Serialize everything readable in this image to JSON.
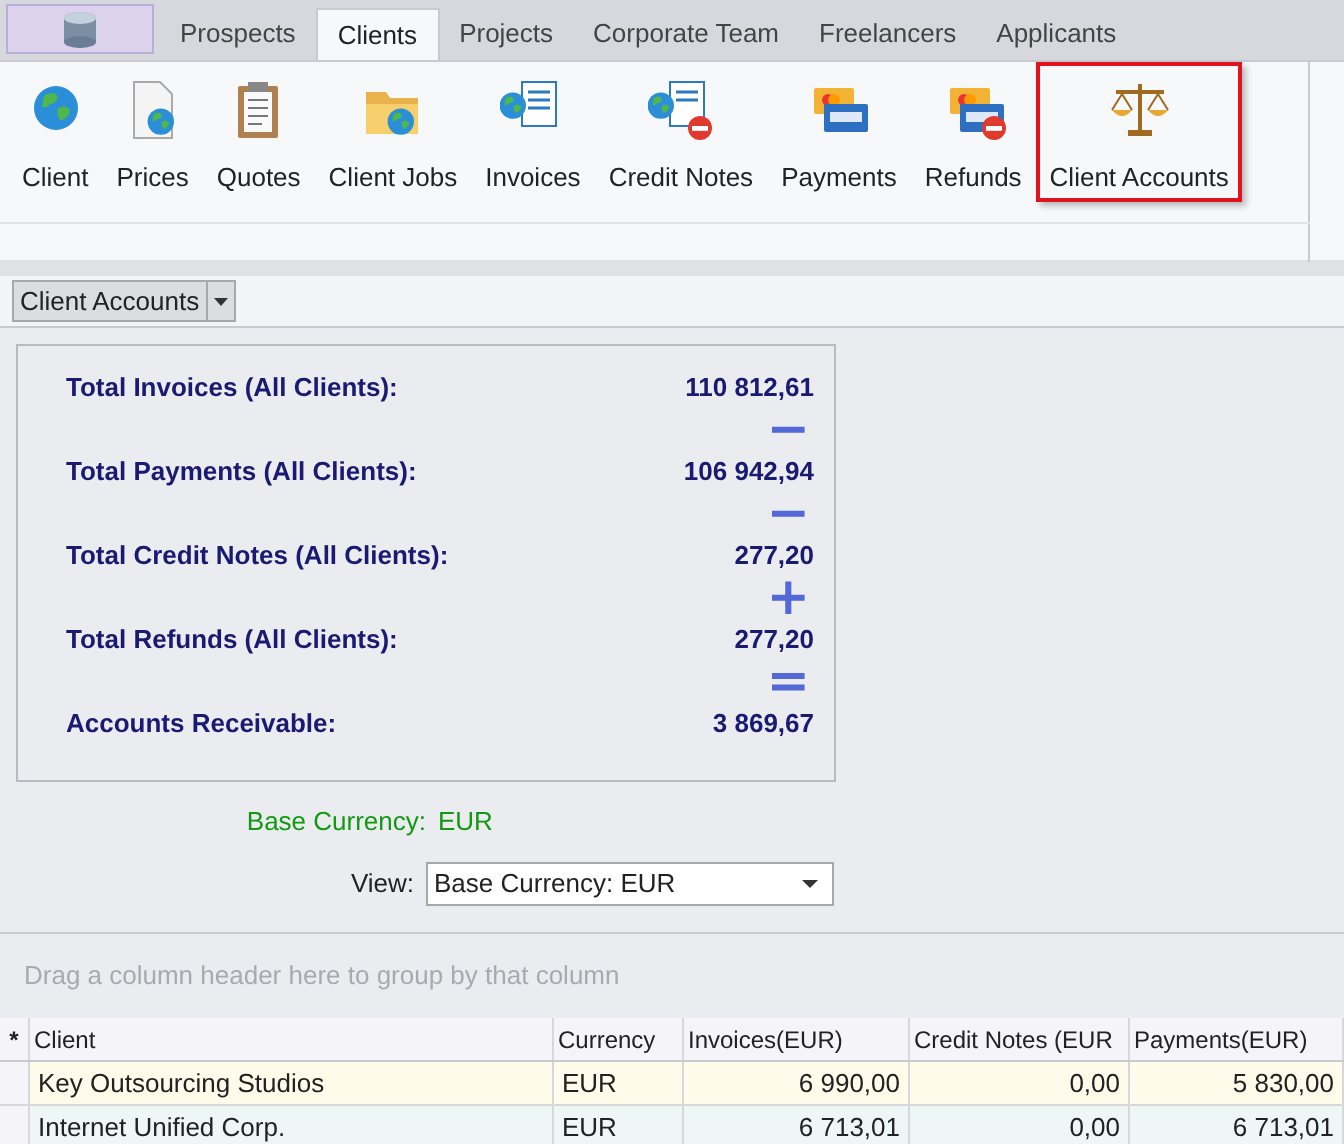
{
  "tabs": [
    {
      "label": "Prospects",
      "selected": false
    },
    {
      "label": "Clients",
      "selected": true
    },
    {
      "label": "Projects",
      "selected": false
    },
    {
      "label": "Corporate Team",
      "selected": false
    },
    {
      "label": "Freelancers",
      "selected": false
    },
    {
      "label": "Applicants",
      "selected": false
    }
  ],
  "ribbon": [
    {
      "label": "Client",
      "selected": false
    },
    {
      "label": "Prices",
      "selected": false
    },
    {
      "label": "Quotes",
      "selected": false
    },
    {
      "label": "Client Jobs",
      "selected": false
    },
    {
      "label": "Invoices",
      "selected": false
    },
    {
      "label": "Credit Notes",
      "selected": false
    },
    {
      "label": "Payments",
      "selected": false
    },
    {
      "label": "Refunds",
      "selected": false
    },
    {
      "label": "Client Accounts",
      "selected": true
    }
  ],
  "view_dropdown": {
    "value": "Client Accounts"
  },
  "summary": [
    {
      "label": "Total Invoices (All Clients):",
      "value": "110 812,61",
      "operator": "−"
    },
    {
      "label": "Total Payments (All Clients):",
      "value": "106 942,94",
      "operator": "−"
    },
    {
      "label": "Total Credit Notes (All Clients):",
      "value": "277,20",
      "operator": "+"
    },
    {
      "label": "Total Refunds (All Clients):",
      "value": "277,20",
      "operator": "="
    },
    {
      "label": "Accounts Receivable:",
      "value": "3 869,67"
    }
  ],
  "base_currency": {
    "label": "Base Currency:",
    "value": "EUR"
  },
  "view": {
    "label": "View:",
    "value": "Base Currency: EUR"
  },
  "grid": {
    "group_hint": "Drag a column header here to group by that column",
    "new_row_marker": "*",
    "columns": [
      "Client",
      "Currency",
      "Invoices(EUR)",
      "Credit Notes (EUR",
      "Payments(EUR)"
    ],
    "rows": [
      {
        "selected": true,
        "cells": [
          "Key Outsourcing Studios",
          "EUR",
          "6 990,00",
          "0,00",
          "5 830,00"
        ]
      },
      {
        "selected": false,
        "cells": [
          "Internet Unified Corp.",
          "EUR",
          "6 713,01",
          "0,00",
          "6 713,01"
        ]
      }
    ]
  }
}
